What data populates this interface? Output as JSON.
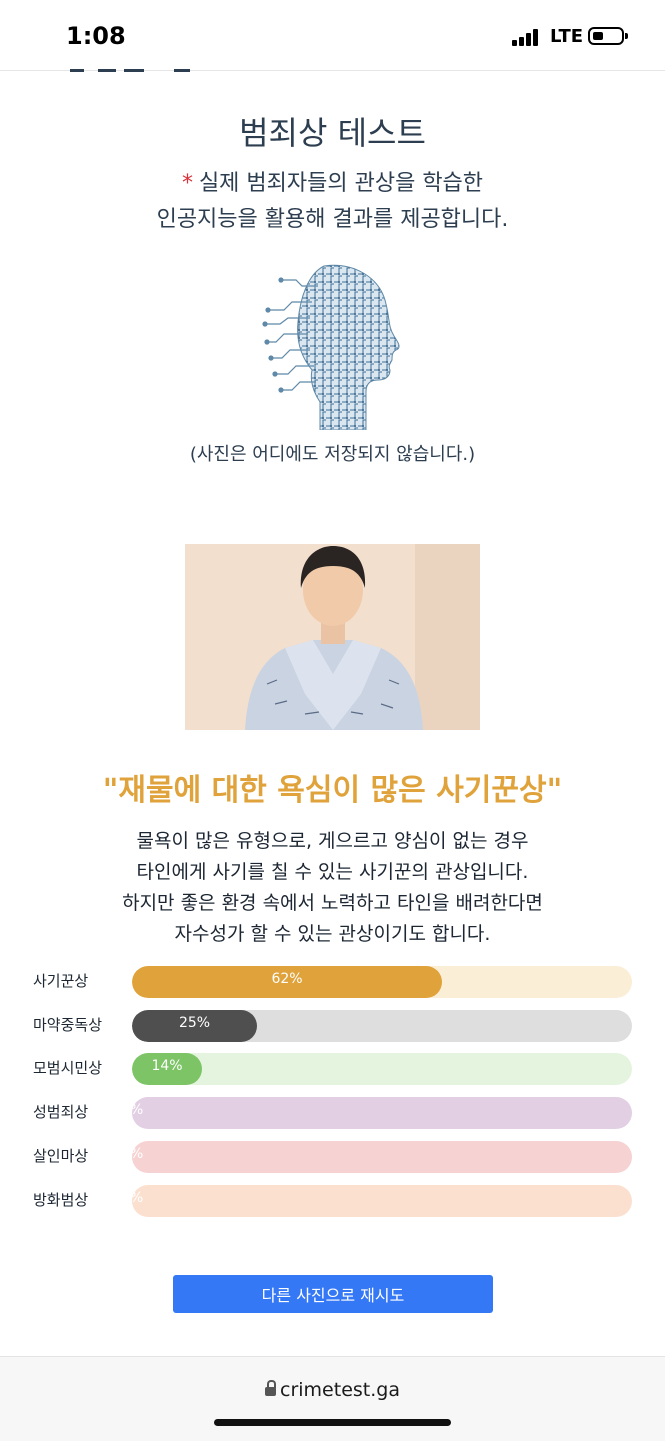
{
  "status_bar": {
    "time": "1:08",
    "network": "LTE"
  },
  "page": {
    "title": "범죄상 테스트",
    "description_star": "*",
    "description_line1": "실제 범죄자들의 관상을 학습한",
    "description_line2": "인공지능을 활용해 결과를 제공합니다.",
    "privacy_notice": "(사진은 어디에도 저장되지 않습니다.)"
  },
  "result": {
    "title": "\"재물에 대한 욕심이 많은 사기꾼상\"",
    "description": [
      "물욕이 많은 유형으로, 게으르고 양심이 없는 경우",
      "타인에게 사기를 칠 수 있는 사기꾼의 관상입니다.",
      "하지만 좋은 환경 속에서 노력하고 타인을 배려한다면",
      "자수성가 할 수 있는 관상이기도 합니다."
    ],
    "bars": [
      {
        "label": "사기꾼상",
        "percent": 62,
        "percent_label": "62%",
        "fill": "#e0a23a",
        "track": "#fbeed6"
      },
      {
        "label": "마약중독상",
        "percent": 25,
        "percent_label": "25%",
        "fill": "#4f4f4f",
        "track": "#dedede"
      },
      {
        "label": "모범시민상",
        "percent": 14,
        "percent_label": "14%",
        "fill": "#7cc466",
        "track": "#e5f4df"
      },
      {
        "label": "성범죄상",
        "percent": 0,
        "percent_label": "%",
        "fill": "#b88fc0",
        "track": "#e2cfe4"
      },
      {
        "label": "살인마상",
        "percent": 0,
        "percent_label": "%",
        "fill": "#e58c8c",
        "track": "#f6d2d2"
      },
      {
        "label": "방화범상",
        "percent": 0,
        "percent_label": "%",
        "fill": "#f0b48a",
        "track": "#fbe0cf"
      }
    ]
  },
  "retry_button": {
    "label": "다른 사진으로 재시도"
  },
  "browser": {
    "url": "crimetest.ga"
  }
}
